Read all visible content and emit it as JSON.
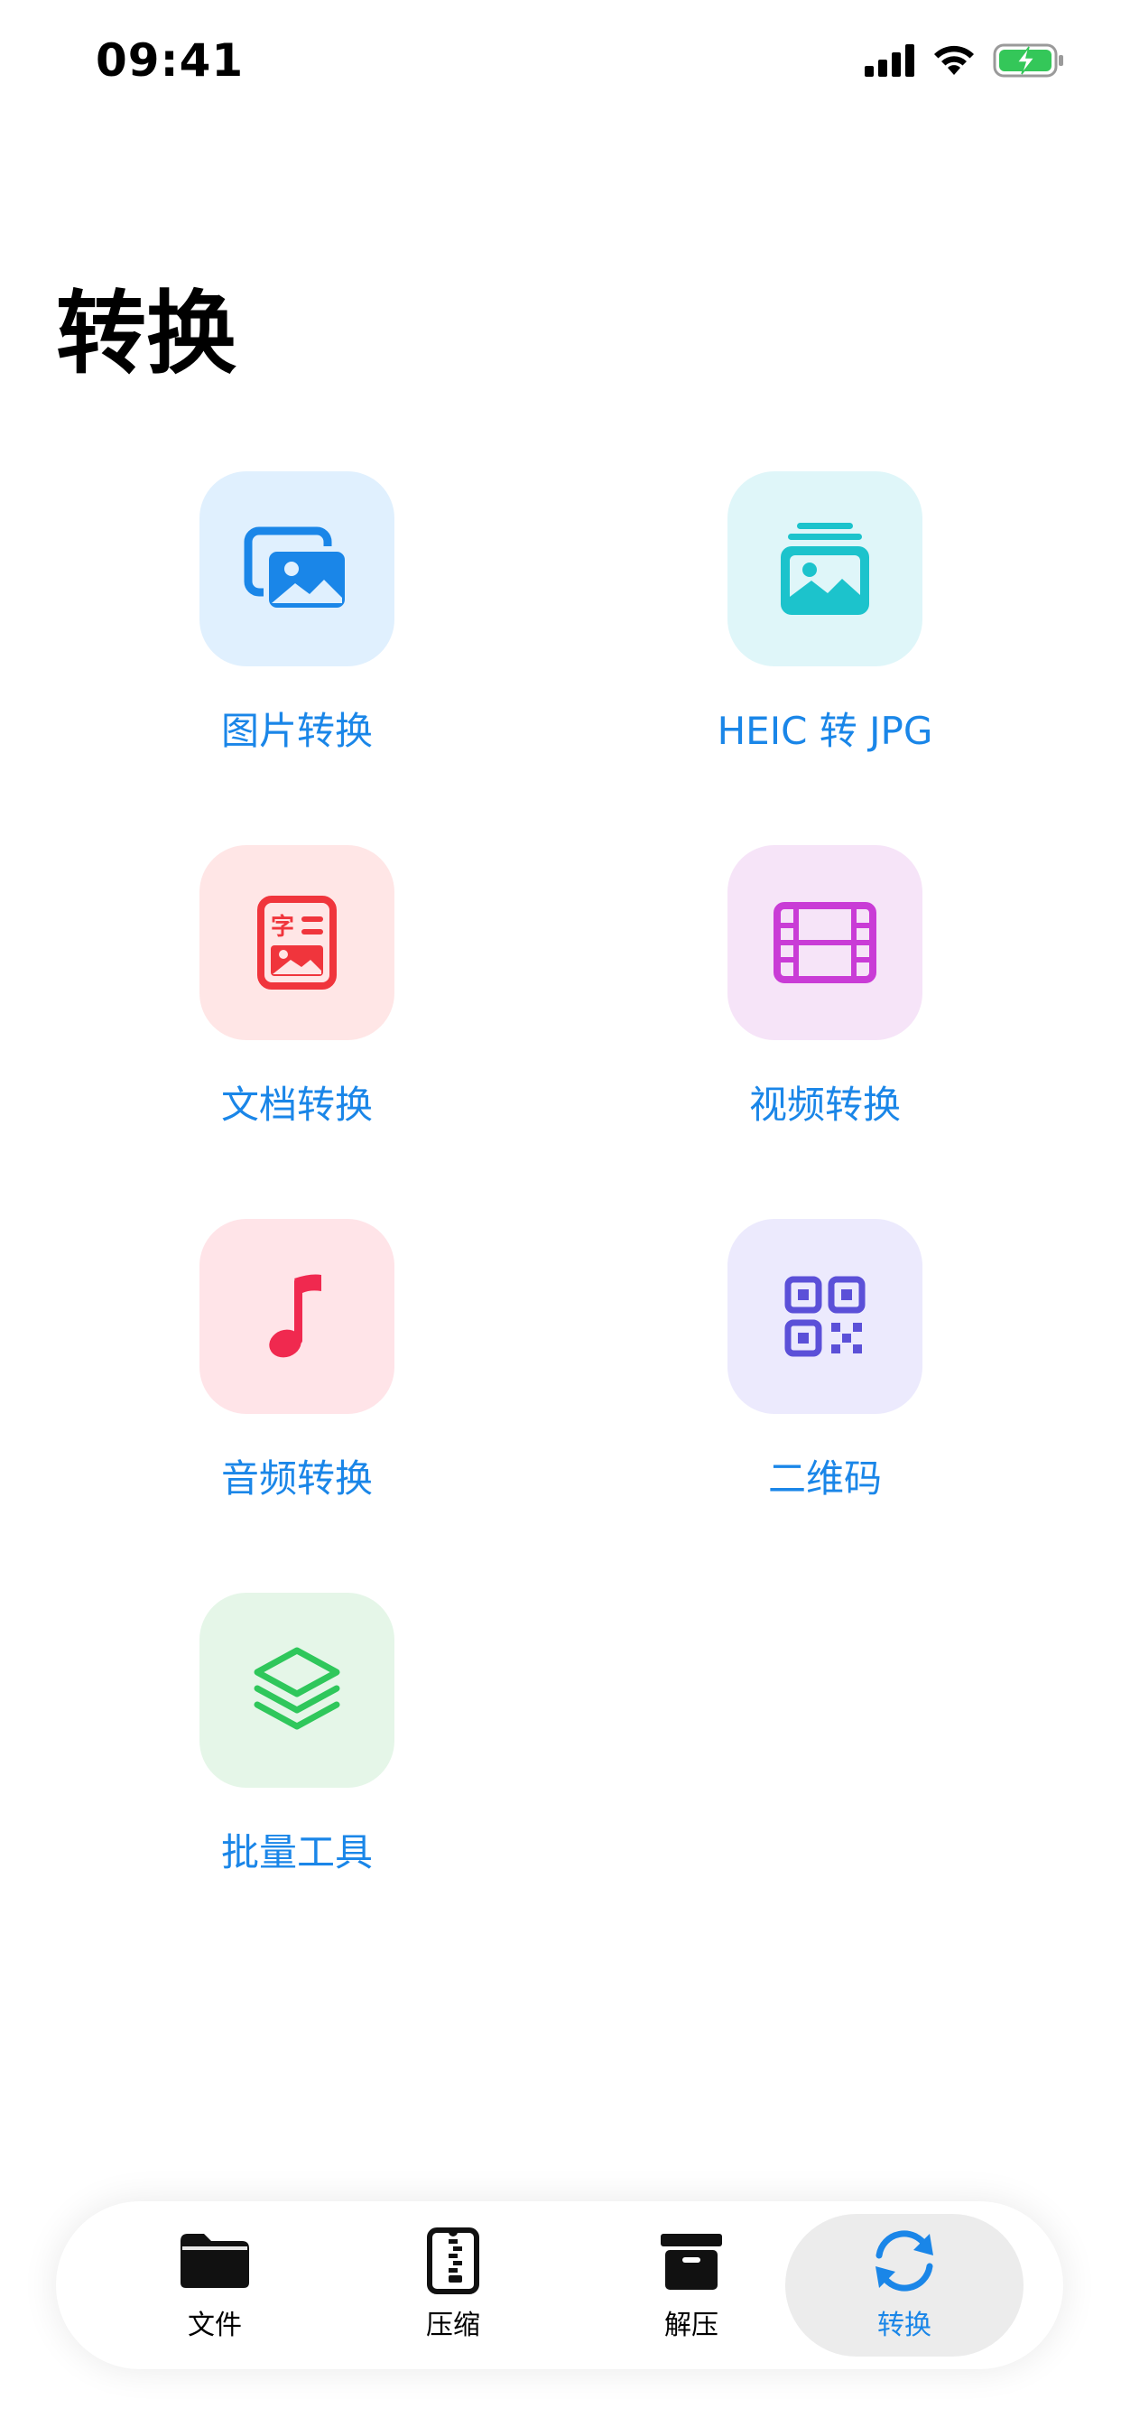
{
  "status_bar": {
    "time": "09:41"
  },
  "header": {
    "title": "转换"
  },
  "tools": [
    {
      "label": "图片转换",
      "tile_color": "#e0f0fe",
      "icon_color": "#1a86e8",
      "icon": "photo-stack-icon"
    },
    {
      "label": "HEIC 转 JPG",
      "tile_color": "#dff6f9",
      "icon_color": "#1cc3cc",
      "icon": "photo-layers-icon"
    },
    {
      "label": "文档转换",
      "tile_color": "#ffe6e6",
      "icon_color": "#f0353c",
      "icon": "document-text-image-icon"
    },
    {
      "label": "视频转换",
      "tile_color": "#f6e4f8",
      "icon_color": "#c93cd6",
      "icon": "film-strip-icon"
    },
    {
      "label": "音频转换",
      "tile_color": "#ffe4e8",
      "icon_color": "#f0294f",
      "icon": "music-note-icon"
    },
    {
      "label": "二维码",
      "tile_color": "#eceafd",
      "icon_color": "#5b50d8",
      "icon": "qr-code-icon"
    },
    {
      "label": "批量工具",
      "tile_color": "#e5f6e8",
      "icon_color": "#2fc75b",
      "icon": "layers-stack-icon"
    }
  ],
  "tabbar": {
    "active_color": "#1a86e8",
    "tabs": [
      {
        "label": "文件",
        "icon": "folder-icon"
      },
      {
        "label": "压缩",
        "icon": "zip-file-icon"
      },
      {
        "label": "解压",
        "icon": "archive-box-icon"
      },
      {
        "label": "转换",
        "icon": "refresh-arrows-icon",
        "active": true
      }
    ]
  }
}
